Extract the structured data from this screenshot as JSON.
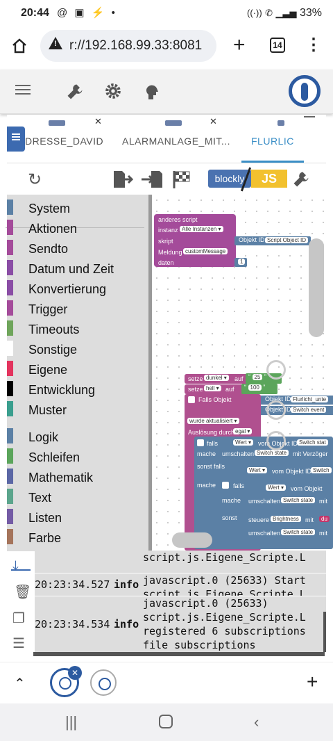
{
  "status": {
    "time": "20:44",
    "icons": "@ ▣ ⚡ •",
    "battery": "33%"
  },
  "browser": {
    "url": "r://192.168.99.33:8081",
    "tab_count": "14"
  },
  "tabs": [
    {
      "label": "DRESSE_DAVID",
      "tag": "blockly"
    },
    {
      "label": "ALARMANLAGE_MIT...",
      "tag": "blockly"
    },
    {
      "label": "FLURLIC",
      "tag": "blockly"
    }
  ],
  "toolbar": {
    "blockly_label": "blockly",
    "js_label": "JS"
  },
  "categories": [
    {
      "label": "System",
      "color": "#5b80a5"
    },
    {
      "label": "Aktionen",
      "color": "#a44b9a"
    },
    {
      "label": "Sendto",
      "color": "#a44b9a"
    },
    {
      "label": "Datum und Zeit",
      "color": "#8a4da5"
    },
    {
      "label": "Konvertierung",
      "color": "#8a4da5"
    },
    {
      "label": "Trigger",
      "color": "#a44b9a"
    },
    {
      "label": "Timeouts",
      "color": "#6fa55b"
    },
    {
      "label": "Sonstige",
      "color": "#ffffff"
    },
    {
      "label": "Eigene",
      "color": "#e3345e"
    },
    {
      "label": "Entwicklung",
      "color": "#000000"
    },
    {
      "label": "Muster",
      "color": "#3a9e8e"
    },
    {
      "label": "Logik",
      "color": "#5b80a5"
    },
    {
      "label": "Schleifen",
      "color": "#5ba55b"
    },
    {
      "label": "Mathematik",
      "color": "#5b67a5"
    },
    {
      "label": "Text",
      "color": "#5ba58c"
    },
    {
      "label": "Listen",
      "color": "#745ba5"
    },
    {
      "label": "Farbe",
      "color": "#a5745b"
    }
  ],
  "blocks": {
    "b1_title": "anderes script",
    "b1_instanz": "instanz",
    "b1_instanz_val": "Alle Instanzen ▾",
    "b1_skript": "skript",
    "b1_objid": "Objekt ID",
    "b1_objid_val": "Script Object ID",
    "b1_meldung": "Meldung",
    "b1_meldung_val": "customMessage",
    "b1_daten": "daten",
    "b1_daten_val": "1",
    "s1": "setze",
    "s1_var": "dunkel ▾",
    "s1_auf": "auf",
    "s1_val": "25",
    "s2": "setze",
    "s2_var": "hell ▾",
    "s2_auf": "auf",
    "s2_val": "100",
    "falls_objekt": "Falls Objekt",
    "fo_objid": "Objekt ID",
    "fo_objid_val": "Flurlicht_unte",
    "fo_objid2": "Objekt ID",
    "fo_objid2_val": "Switch event",
    "wurde": "wurde aktualisiert ▾",
    "ausloesung": "Auslösung durch",
    "ausloesung_val": "egal ▾",
    "falls": "falls",
    "wert": "Wert ▾",
    "vom_objid": "vom Objekt ID",
    "switch_stat": "Switch stat",
    "mache": "mache",
    "umschalten": "umschalten",
    "switch_state": "Switch state",
    "mit_verz": "mit Verzöger",
    "sonst_falls": "sonst falls",
    "wert2": "Wert ▾",
    "vom_objid2": "vom Objekt ID",
    "switch2": "Switch",
    "mache2": "mache",
    "falls2": "falls",
    "wert3": "Wert ▾",
    "vom_objid3": "vom Objekt",
    "mache3": "mache",
    "umschalten2": "umschalten",
    "switch_state2": "Switch state",
    "mit2": "mit",
    "sonst": "sonst",
    "steuere": "steuere",
    "brightness": "Brightness",
    "mit3": "mit",
    "du": "du",
    "umschalten3": "umschalten",
    "switch_state3": "Switch state",
    "mit4": "mit"
  },
  "log": [
    {
      "time": "",
      "level": "",
      "msg": "script.js.Eigene_Scripte.L"
    },
    {
      "time": "20:23:34.527",
      "level": "info",
      "msg": "javascript.0 (25633) Start\nscript.js.Eigene_Scripte.L"
    },
    {
      "time": "20:23:34.534",
      "level": "info",
      "msg": "javascript.0 (25633)\nscript.js.Eigene_Scripte.L\nregistered 6 subscriptions\nfile subscriptions"
    }
  ]
}
